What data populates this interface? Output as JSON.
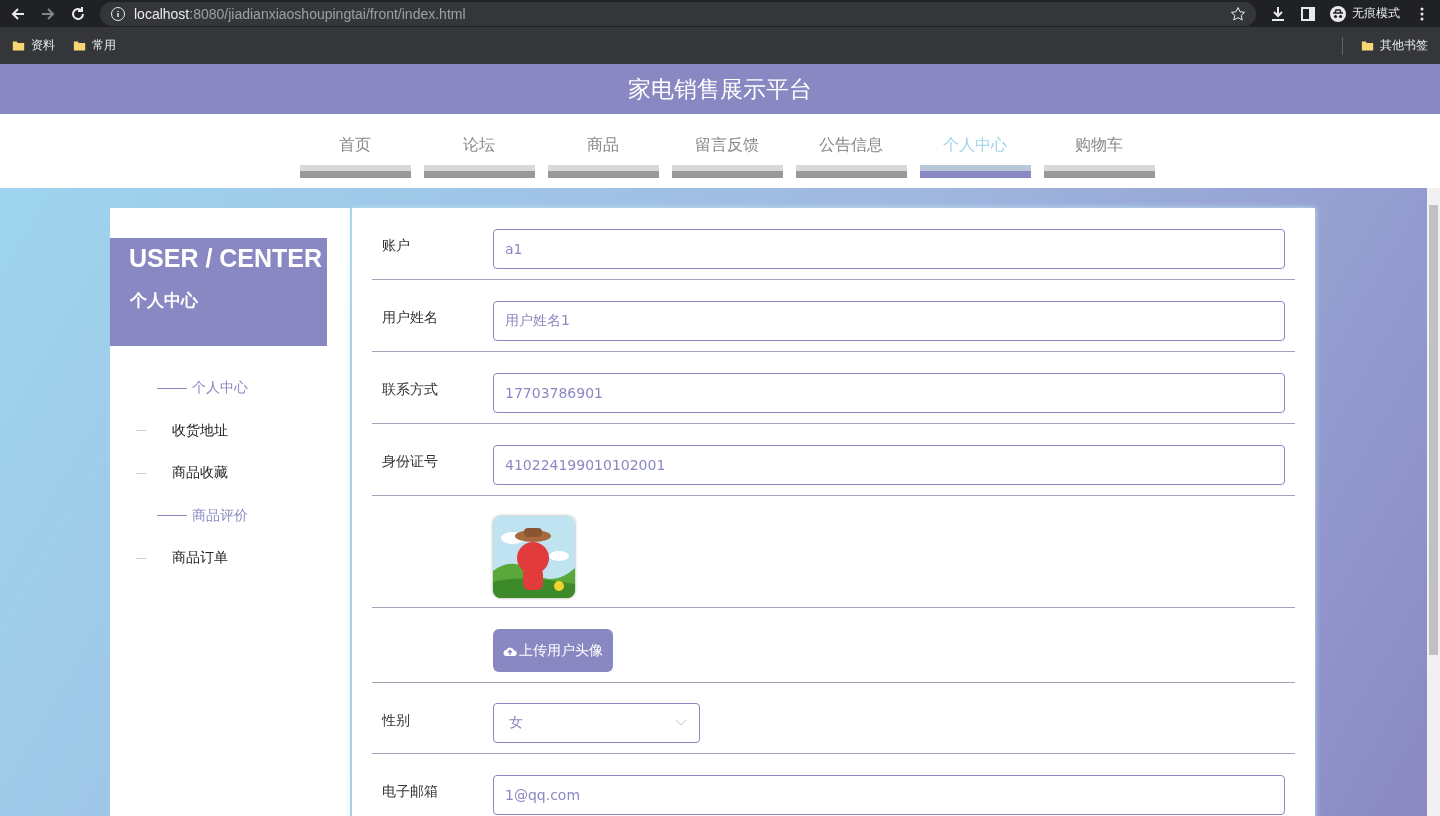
{
  "browser": {
    "url_host": "localhost",
    "url_rest": ":8080/jiadianxiaoshoupingtai/front/index.html",
    "incognito_label": "无痕模式",
    "bookmarks": [
      "资料",
      "常用"
    ],
    "other_bookmarks": "其他书签"
  },
  "site_title": "家电销售展示平台",
  "nav": [
    {
      "label": "首页",
      "selected": false
    },
    {
      "label": "论坛",
      "selected": false
    },
    {
      "label": "商品",
      "selected": false
    },
    {
      "label": "留言反馈",
      "selected": false
    },
    {
      "label": "公告信息",
      "selected": false
    },
    {
      "label": "个人中心",
      "selected": true
    },
    {
      "label": "购物车",
      "selected": false
    }
  ],
  "side": {
    "title": "USER / CENTER",
    "subtitle": "个人中心",
    "items": [
      {
        "label": "个人中心",
        "active": true
      },
      {
        "label": "收货地址",
        "active": false
      },
      {
        "label": "商品收藏",
        "active": false
      },
      {
        "label": "商品评价",
        "active": true
      },
      {
        "label": "商品订单",
        "active": false
      }
    ]
  },
  "form": {
    "fields": [
      {
        "kind": "text",
        "label": "账户",
        "value": "a1"
      },
      {
        "kind": "text",
        "label": "用户姓名",
        "value": "用户姓名1"
      },
      {
        "kind": "text",
        "label": "联系方式",
        "value": "17703786901"
      },
      {
        "kind": "text",
        "label": "身份证号",
        "value": "410224199010102001"
      },
      {
        "kind": "picture"
      },
      {
        "kind": "button",
        "label": "上传用户头像"
      },
      {
        "kind": "select",
        "label": "性别",
        "value": "女"
      },
      {
        "kind": "text",
        "label": "电子邮箱",
        "value": "1@qq.com"
      }
    ]
  }
}
